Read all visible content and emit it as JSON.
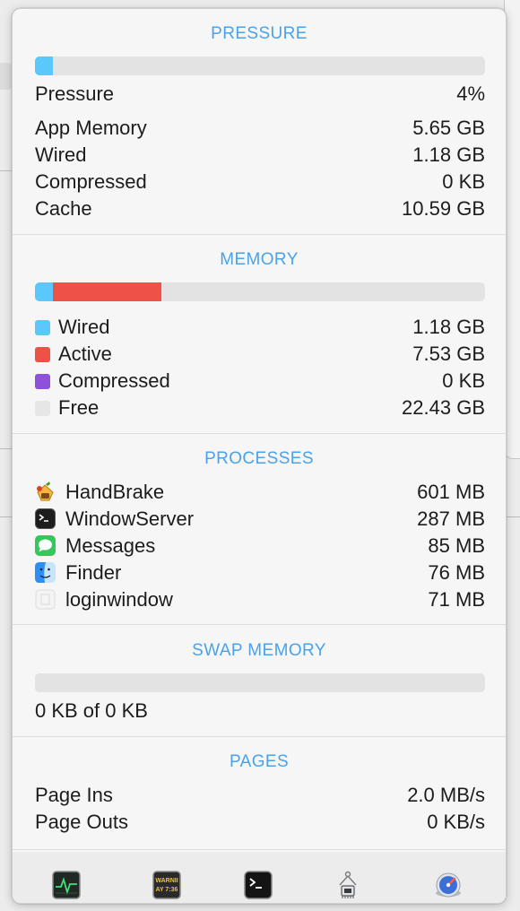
{
  "pressure": {
    "title": "PRESSURE",
    "bar_fraction": 0.04,
    "bar_color": "#5ac8fa",
    "rows": [
      {
        "label": "Pressure",
        "value": "4%"
      },
      {
        "label": "App Memory",
        "value": "5.65 GB"
      },
      {
        "label": "Wired",
        "value": "1.18 GB"
      },
      {
        "label": "Compressed",
        "value": "0 KB"
      },
      {
        "label": "Cache",
        "value": "10.59 GB"
      }
    ]
  },
  "memory": {
    "title": "MEMORY",
    "segments": [
      {
        "name": "Wired",
        "fraction": 0.04,
        "color": "#5ac8fa"
      },
      {
        "name": "Active",
        "fraction": 0.24,
        "color": "#ee5247"
      },
      {
        "name": "Compressed",
        "fraction": 0.0,
        "color": "#8e52d8"
      }
    ],
    "rows": [
      {
        "label": "Wired",
        "value": "1.18 GB",
        "color": "#5ac8fa"
      },
      {
        "label": "Active",
        "value": "7.53 GB",
        "color": "#ee5247"
      },
      {
        "label": "Compressed",
        "value": "0 KB",
        "color": "#8e52d8"
      },
      {
        "label": "Free",
        "value": "22.43 GB",
        "color": "#e6e6e6"
      }
    ]
  },
  "processes": {
    "title": "PROCESSES",
    "rows": [
      {
        "label": "HandBrake",
        "value": "601 MB",
        "icon": "handbrake-icon"
      },
      {
        "label": "WindowServer",
        "value": "287 MB",
        "icon": "terminal-icon"
      },
      {
        "label": "Messages",
        "value": "85 MB",
        "icon": "messages-icon"
      },
      {
        "label": "Finder",
        "value": "76 MB",
        "icon": "finder-icon"
      },
      {
        "label": "loginwindow",
        "value": "71 MB",
        "icon": "loginwindow-icon"
      }
    ]
  },
  "swap": {
    "title": "SWAP MEMORY",
    "bar_fraction": 0.0,
    "usage_text": "0 KB of 0 KB"
  },
  "pages": {
    "title": "PAGES",
    "rows": [
      {
        "label": "Page Ins",
        "value": "2.0 MB/s"
      },
      {
        "label": "Page Outs",
        "value": "0 KB/s"
      }
    ]
  },
  "toolbar": {
    "buttons": [
      {
        "icon": "activity-monitor-icon"
      },
      {
        "icon": "console-icon",
        "text_line1": "WARNII",
        "text_line2": "AY 7:36"
      },
      {
        "icon": "terminal-icon"
      },
      {
        "icon": "system-information-icon"
      },
      {
        "icon": "disk-utility-icon"
      }
    ]
  }
}
